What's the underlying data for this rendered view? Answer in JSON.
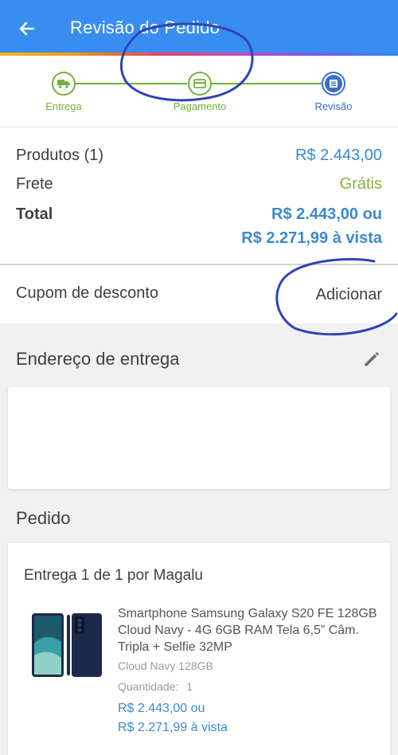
{
  "header": {
    "title": "Revisão do Pedido",
    "back_icon": "arrow-left-icon",
    "color": "#3a8df0"
  },
  "stepper": {
    "steps": [
      {
        "label": "Entrega",
        "icon": "truck-icon",
        "state": "done"
      },
      {
        "label": "Pagamento",
        "icon": "card-icon",
        "state": "done"
      },
      {
        "label": "Revisão",
        "icon": "list-icon",
        "state": "current"
      }
    ],
    "done_color": "#70b23a",
    "current_color": "#3a6fc9"
  },
  "summary": {
    "products_label": "Produtos (1)",
    "products_value": "R$ 2.443,00",
    "shipping_label": "Frete",
    "shipping_value": "Grátis",
    "total_label": "Total",
    "total_value": "R$ 2.443,00 ou",
    "total_cash_value": "R$ 2.271,99 à vista"
  },
  "coupon": {
    "label": "Cupom de desconto",
    "action": "Adicionar"
  },
  "address": {
    "title": "Endereço de entrega",
    "edit_icon": "pencil-icon"
  },
  "order": {
    "title": "Pedido",
    "delivery_label": "Entrega 1 de 1 por Magalu",
    "product": {
      "name": "Smartphone Samsung Galaxy S20 FE 128GB Cloud Navy - 4G 6GB RAM Tela 6,5” Câm. Tripla + Selfie 32MP",
      "variant": "Cloud Navy 128GB",
      "quantity_label": "Quantidade:",
      "quantity": "1",
      "price": "R$ 2.443,00 ou",
      "price_cash": "R$ 2.271,99 à vista"
    }
  }
}
